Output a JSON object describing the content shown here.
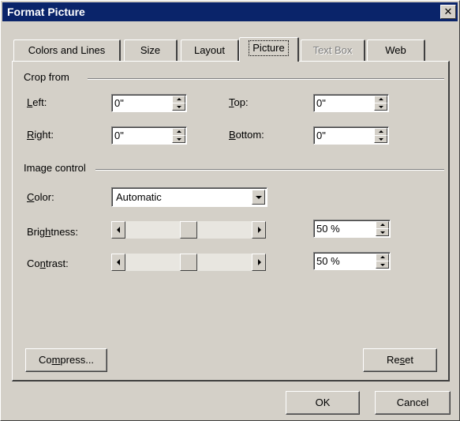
{
  "window": {
    "title": "Format Picture",
    "close_glyph": "✕"
  },
  "tabs": [
    {
      "label": "Colors and Lines"
    },
    {
      "label": "Size"
    },
    {
      "label": "Layout"
    },
    {
      "label": "Picture"
    },
    {
      "label": "Text Box"
    },
    {
      "label": "Web"
    }
  ],
  "crop": {
    "group_label": "Crop from",
    "left": {
      "label_u": "L",
      "label_rest": "eft:",
      "value": "0\""
    },
    "right": {
      "label_u": "R",
      "label_rest": "ight:",
      "value": "0\""
    },
    "top": {
      "label_u": "T",
      "label_rest": "op:",
      "value": "0\""
    },
    "bottom": {
      "label_u": "B",
      "label_rest": "ottom:",
      "value": "0\""
    }
  },
  "image_control": {
    "group_label": "Image control",
    "color": {
      "label_u": "C",
      "label_rest": "olor:",
      "value": "Automatic"
    },
    "brightness": {
      "label_pre": "Brig",
      "label_u": "h",
      "label_rest": "tness:",
      "value": "50 %",
      "level_percent": 50
    },
    "contrast": {
      "label_pre": "Co",
      "label_u": "n",
      "label_rest": "trast:",
      "value": "50 %",
      "level_percent": 50
    }
  },
  "buttons": {
    "compress": {
      "pre": "Co",
      "u": "m",
      "rest": "press..."
    },
    "reset": {
      "pre": "Re",
      "u": "s",
      "rest": "et"
    },
    "ok": "OK",
    "cancel": "Cancel"
  }
}
